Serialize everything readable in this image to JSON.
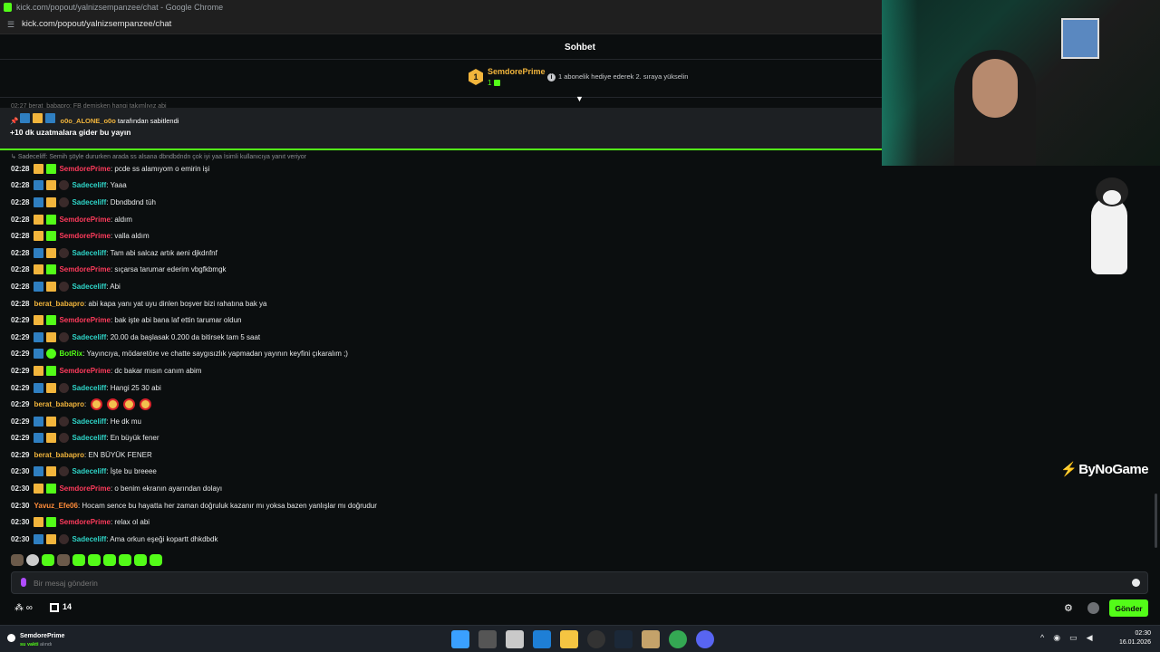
{
  "window": {
    "title": "kick.com/popout/yalnizsempanzee/chat - Google Chrome",
    "url": "kick.com/popout/yalnizsempanzee/chat"
  },
  "chat": {
    "header": "Sohbet",
    "top_gifter": {
      "rank": "1",
      "name": "SemdorePrime",
      "count": "1"
    },
    "promo": "1 abonelik hediye ederek 2. sıraya yükselin",
    "ghost_line": "02:27 berat_babapro: FB demişken hangi takımlıyız abi",
    "pinned": {
      "by_user": "o0o_ALONE_o0o",
      "by_suffix": "tarafından sabitlendi",
      "message": "+10 dk uzatmalara gider bu yayın"
    },
    "reply_context": "Sadeceliff: Semih şöyle dururken arada ss alsana dbndbdndn çok iyi yaa İsimli kullanıcıya yanıt veriyor",
    "messages": [
      {
        "ts": "02:28",
        "user": "SemdorePrime",
        "text": ": pcde ss alamıyom o emirin işi",
        "badges": [
          "crown",
          "gift"
        ],
        "color": "red"
      },
      {
        "ts": "02:28",
        "user": "Sadeceliff",
        "text": ": Yaaa",
        "badges": [
          "mod",
          "crown",
          "ape"
        ],
        "color": "cyan"
      },
      {
        "ts": "02:28",
        "user": "Sadeceliff",
        "text": ": Dbndbdnd tüh",
        "badges": [
          "mod",
          "crown",
          "ape"
        ],
        "color": "cyan"
      },
      {
        "ts": "02:28",
        "user": "SemdorePrime",
        "text": ": aldım",
        "badges": [
          "crown",
          "gift"
        ],
        "color": "red"
      },
      {
        "ts": "02:28",
        "user": "SemdorePrime",
        "text": ": valla aldım",
        "badges": [
          "crown",
          "gift"
        ],
        "color": "red"
      },
      {
        "ts": "02:28",
        "user": "Sadeceliff",
        "text": ": Tam abi salcaz artık aeni djkdnfnf",
        "badges": [
          "mod",
          "crown",
          "ape"
        ],
        "color": "cyan"
      },
      {
        "ts": "02:28",
        "user": "SemdorePrime",
        "text": ": sıçarsa tarumar ederim vbgfkbmgk",
        "badges": [
          "crown",
          "gift"
        ],
        "color": "red"
      },
      {
        "ts": "02:28",
        "user": "Sadeceliff",
        "text": ": Abi",
        "badges": [
          "mod",
          "crown",
          "ape"
        ],
        "color": "cyan"
      },
      {
        "ts": "02:28",
        "user": "berat_babapro",
        "text": ": abi kapa yanı yat uyu dinlen boşver bizi rahatına bak ya",
        "badges": [],
        "color": "gold"
      },
      {
        "ts": "02:29",
        "user": "SemdorePrime",
        "text": ": bak işte abi bana laf ettin tarumar oldun",
        "badges": [
          "crown",
          "gift"
        ],
        "color": "red"
      },
      {
        "ts": "02:29",
        "user": "Sadeceliff",
        "text": ": 20.00 da başlasak 0.200 da bitirsek tam 5 saat",
        "badges": [
          "mod",
          "crown",
          "ape"
        ],
        "color": "cyan"
      },
      {
        "ts": "02:29",
        "user": "BotRix",
        "text": ": Yayıncıya, mödaretöre ve chatte saygısızlık yapmadan yayının keyfini çıkaralım ;)",
        "badges": [
          "mod",
          "bot"
        ],
        "color": "green"
      },
      {
        "ts": "02:29",
        "user": "SemdorePrime",
        "text": ": dc bakar mısın canım abim",
        "badges": [
          "crown",
          "gift"
        ],
        "color": "red"
      },
      {
        "ts": "02:29",
        "user": "Sadeceliff",
        "text": ": Hangi 25 30 abi",
        "badges": [
          "mod",
          "crown",
          "ape"
        ],
        "color": "cyan"
      },
      {
        "ts": "02:29",
        "user": "berat_babapro",
        "text": ":",
        "badges": [],
        "color": "gold",
        "emotes": 4
      },
      {
        "ts": "02:29",
        "user": "Sadeceliff",
        "text": ": He dk mu",
        "badges": [
          "mod",
          "crown",
          "ape"
        ],
        "color": "cyan"
      },
      {
        "ts": "02:29",
        "user": "Sadeceliff",
        "text": ": En büyük fener",
        "badges": [
          "mod",
          "crown",
          "ape"
        ],
        "color": "cyan"
      },
      {
        "ts": "02:29",
        "user": "berat_babapro",
        "text": ": EN BÜYÜK FENER",
        "badges": [],
        "color": "gold"
      },
      {
        "ts": "02:30",
        "user": "Sadeceliff",
        "text": ": İşte bu breeee",
        "badges": [
          "mod",
          "crown",
          "ape"
        ],
        "color": "cyan"
      },
      {
        "ts": "02:30",
        "user": "SemdorePrime",
        "text": ": o benim ekranın ayarından dolayı",
        "badges": [
          "crown",
          "gift"
        ],
        "color": "red"
      },
      {
        "ts": "02:30",
        "user": "Yavuz_Efe06",
        "text": ": Hocam sence bu hayatta her zaman doğruluk kazanır mı yoksa bazen yanlışlar mı doğrudur",
        "badges": [],
        "color": "orange"
      },
      {
        "ts": "02:30",
        "user": "SemdorePrime",
        "text": ": relax ol abi",
        "badges": [
          "crown",
          "gift"
        ],
        "color": "red"
      },
      {
        "ts": "02:30",
        "user": "Sadeceliff",
        "text": ": Ama orkun eşeği kopartt dhkdbdk",
        "badges": [
          "mod",
          "crown",
          "ape"
        ],
        "color": "cyan"
      }
    ],
    "input": {
      "placeholder": "Bir mesaj gönderin"
    },
    "points": "∞",
    "gift_count": "14",
    "send_label": "Gönder"
  },
  "overlay": {
    "watermark": "ByNoGame"
  },
  "taskbar": {
    "user_name": "SemdorePrime",
    "user_status_highlight": "su vakti",
    "user_status_rest": "alındı",
    "time": "02:30",
    "date": "16.01.2026"
  },
  "colors": {
    "accent": "#53fc18",
    "red_user": "#ff3b5c",
    "cyan_user": "#2fd6c9",
    "gold_user": "#f2b53c"
  }
}
